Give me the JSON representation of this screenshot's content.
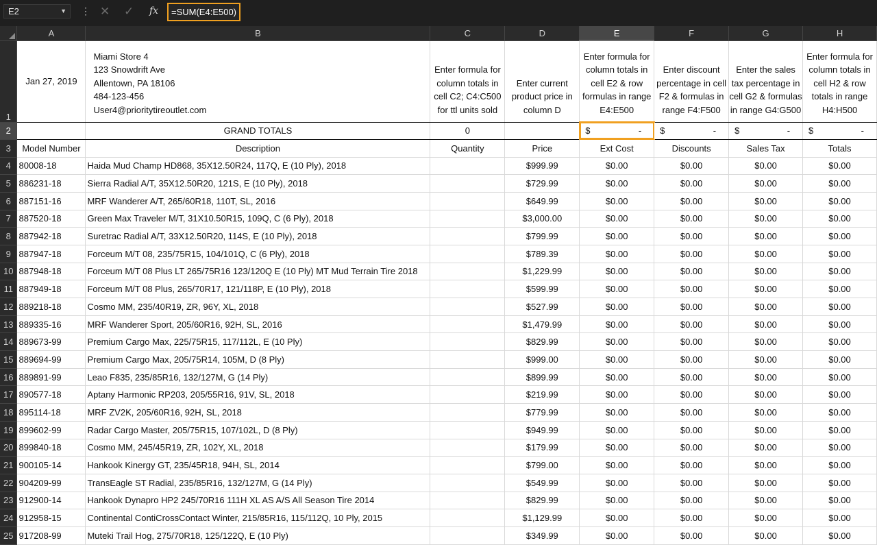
{
  "formula_bar": {
    "name_box": "E2",
    "formula": "=SUM(E4:E500)",
    "cancel_icon": "✕",
    "enter_icon": "✓",
    "fx_label": "fx"
  },
  "columns": [
    "A",
    "B",
    "C",
    "D",
    "E",
    "F",
    "G",
    "H"
  ],
  "header_row": {
    "date": "Jan 27, 2019",
    "address_lines": [
      "Miami Store 4",
      "123 Snowdrift Ave",
      "Allentown, PA 18106",
      "484-123-456",
      "User4@prioritytireoutlet.com"
    ],
    "instr_c": "Enter formula for column totals in cell C2; C4:C500 for ttl units sold",
    "instr_d": "Enter current product price in column D",
    "instr_e": "Enter formula for column totals in cell E2 & row formulas in range E4:E500",
    "instr_f": "Enter discount percentage in cell F2 & formulas in range F4:F500",
    "instr_g": "Enter the sales tax percentage in cell G2 & formulas in range G4:G500",
    "instr_h": "Enter formula for column totals in cell H2 & row totals in range H4:H500"
  },
  "totals_row": {
    "label": "GRAND TOTALS",
    "quantity": "0",
    "currency": "$",
    "dash": "-"
  },
  "table_headers": [
    "Model Number",
    "Description",
    "Quantity",
    "Price",
    "Ext Cost",
    "Discounts",
    "Sales Tax",
    "Totals"
  ],
  "rows": [
    {
      "n": "4",
      "model": "80008-18",
      "desc": "Haida Mud Champ HD868, 35X12.50R24, 117Q, E (10 Ply), 2018",
      "price": "$999.99"
    },
    {
      "n": "5",
      "model": "886231-18",
      "desc": "Sierra Radial A/T, 35X12.50R20, 121S, E (10 Ply), 2018",
      "price": "$729.99"
    },
    {
      "n": "6",
      "model": "887151-16",
      "desc": "MRF Wanderer A/T, 265/60R18, 110T, SL, 2016",
      "price": "$649.99"
    },
    {
      "n": "7",
      "model": "887520-18",
      "desc": "Green Max Traveler M/T, 31X10.50R15, 109Q, C (6 Ply), 2018",
      "price": "$3,000.00"
    },
    {
      "n": "8",
      "model": "887942-18",
      "desc": "Suretrac Radial A/T, 33X12.50R20, 114S, E (10 Ply), 2018",
      "price": "$799.99"
    },
    {
      "n": "9",
      "model": "887947-18",
      "desc": "Forceum M/T 08, 235/75R15, 104/101Q, C (6 Ply), 2018",
      "price": "$789.39"
    },
    {
      "n": "10",
      "model": "887948-18",
      "desc": "Forceum M/T 08 Plus LT 265/75R16 123/120Q E (10 Ply) MT Mud Terrain Tire 2018",
      "price": "$1,229.99"
    },
    {
      "n": "11",
      "model": "887949-18",
      "desc": "Forceum M/T 08 Plus, 265/70R17, 121/118P, E (10 Ply), 2018",
      "price": "$599.99"
    },
    {
      "n": "12",
      "model": "889218-18",
      "desc": "Cosmo MM, 235/40R19, ZR, 96Y, XL, 2018",
      "price": "$527.99"
    },
    {
      "n": "13",
      "model": "889335-16",
      "desc": "MRF Wanderer Sport, 205/60R16, 92H, SL, 2016",
      "price": "$1,479.99"
    },
    {
      "n": "14",
      "model": "889673-99",
      "desc": "Premium Cargo Max, 225/75R15, 117/112L, E (10 Ply)",
      "price": "$829.99"
    },
    {
      "n": "15",
      "model": "889694-99",
      "desc": "Premium Cargo Max, 205/75R14, 105M, D (8 Ply)",
      "price": "$999.00"
    },
    {
      "n": "16",
      "model": "889891-99",
      "desc": "Leao F835, 235/85R16, 132/127M, G (14 Ply)",
      "price": "$899.99"
    },
    {
      "n": "17",
      "model": "890577-18",
      "desc": "Aptany Harmonic RP203, 205/55R16, 91V, SL, 2018",
      "price": "$219.99"
    },
    {
      "n": "18",
      "model": "895114-18",
      "desc": "MRF ZV2K, 205/60R16, 92H, SL, 2018",
      "price": "$779.99"
    },
    {
      "n": "19",
      "model": "899602-99",
      "desc": "Radar Cargo Master, 205/75R15, 107/102L, D (8 Ply)",
      "price": "$949.99"
    },
    {
      "n": "20",
      "model": "899840-18",
      "desc": "Cosmo MM, 245/45R19, ZR, 102Y, XL, 2018",
      "price": "$179.99"
    },
    {
      "n": "21",
      "model": "900105-14",
      "desc": "Hankook Kinergy GT, 235/45R18, 94H, SL, 2014",
      "price": "$799.00"
    },
    {
      "n": "22",
      "model": "904209-99",
      "desc": "TransEagle ST Radial, 235/85R16, 132/127M, G (14 Ply)",
      "price": "$549.99"
    },
    {
      "n": "23",
      "model": "912900-14",
      "desc": "Hankook Dynapro HP2 245/70R16 111H XL AS A/S All Season Tire 2014",
      "price": "$829.99"
    },
    {
      "n": "24",
      "model": "912958-15",
      "desc": "Continental ContiCrossContact Winter, 215/85R16, 115/112Q, 10 Ply, 2015",
      "price": "$1,129.99"
    },
    {
      "n": "25",
      "model": "917208-99",
      "desc": "Muteki Trail Hog, 275/70R18, 125/122Q, E (10 Ply)",
      "price": "$349.99"
    }
  ],
  "zero_value": "$0.00",
  "colors": {
    "accent": "#f0a020",
    "chrome": "#1f1f1f",
    "header": "#2b2b2b"
  }
}
